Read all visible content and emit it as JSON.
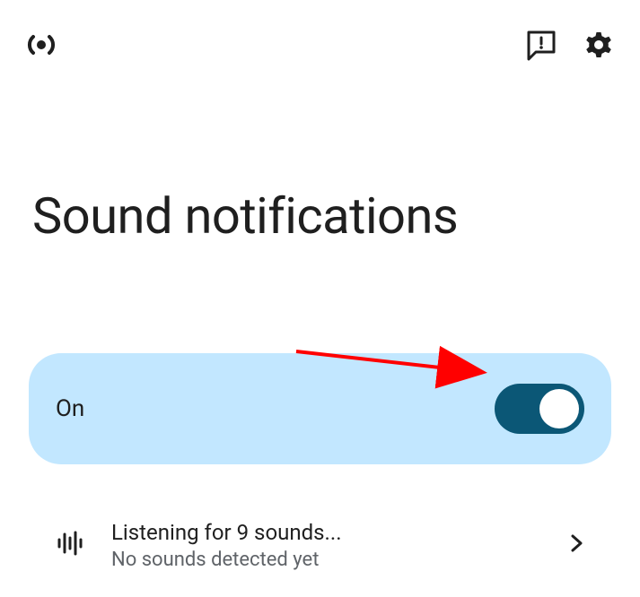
{
  "page": {
    "title": "Sound notifications"
  },
  "toggle": {
    "label": "On",
    "enabled": true
  },
  "listening": {
    "title": "Listening for 9 sounds...",
    "subtitle": "No sounds detected yet"
  }
}
